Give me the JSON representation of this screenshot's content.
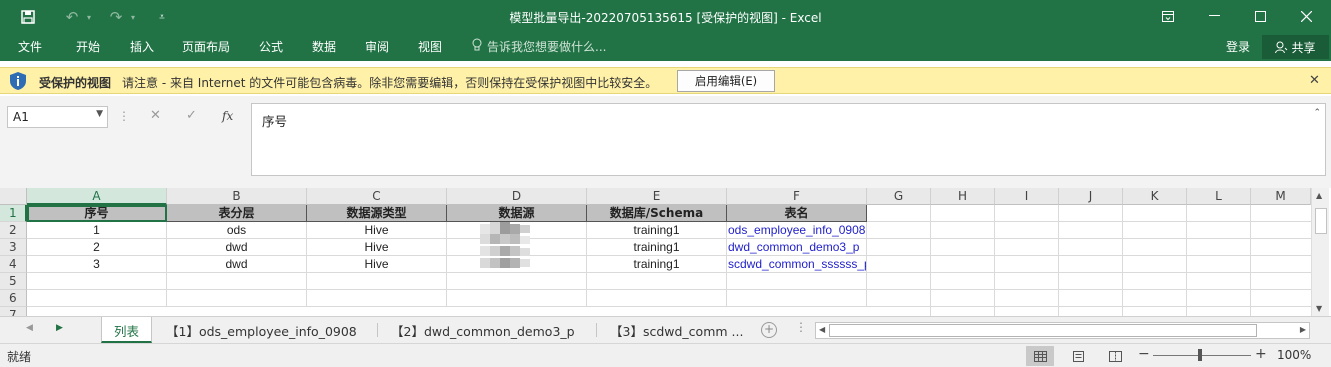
{
  "titlebar": {
    "title": "模型批量导出-20220705135615  [受保护的视图] - Excel",
    "save_icon": "save-icon",
    "undo_icon": "undo-icon",
    "redo_icon": "redo-icon",
    "customize_icon": "customize-qa-icon"
  },
  "ribbon": {
    "tabs": [
      "文件",
      "开始",
      "插入",
      "页面布局",
      "公式",
      "数据",
      "审阅",
      "视图"
    ],
    "tell_me": "告诉我您想要做什么...",
    "login": "登录",
    "share": "共享"
  },
  "protected_view": {
    "title": "受保护的视图",
    "message": "请注意 - 来自 Internet 的文件可能包含病毒。除非您需要编辑，否则保持在受保护视图中比较安全。",
    "enable_button": "启用编辑(E)"
  },
  "formula_bar": {
    "name_box": "A1",
    "fx": "fx",
    "content": "序号"
  },
  "grid": {
    "columns": [
      "A",
      "B",
      "C",
      "D",
      "E",
      "F",
      "G",
      "H",
      "I",
      "J",
      "K",
      "L",
      "M"
    ],
    "rows": [
      "1",
      "2",
      "3",
      "4",
      "5",
      "6",
      "7"
    ],
    "header_row": [
      "序号",
      "表分层",
      "数据源类型",
      "数据源",
      "数据库/Schema",
      "表名"
    ],
    "data_rows": [
      [
        "1",
        "ods",
        "Hive",
        "",
        "training1",
        "ods_employee_info_0908"
      ],
      [
        "2",
        "dwd",
        "Hive",
        "",
        "training1",
        "dwd_common_demo3_p"
      ],
      [
        "3",
        "dwd",
        "Hive",
        "",
        "training1",
        "scdwd_common_ssssss_p"
      ]
    ]
  },
  "sheets": {
    "tabs": [
      "列表",
      "【1】ods_employee_info_0908",
      "【2】dwd_common_demo3_p",
      "【3】scdwd_comm  ..."
    ],
    "active": 0
  },
  "status": {
    "text": "就绪",
    "zoom": "100%"
  },
  "colors": {
    "excel_green": "#217346",
    "protected_bar": "#fff1a8",
    "header_fill": "#c0c0c0",
    "link_blue": "#2222cc"
  }
}
